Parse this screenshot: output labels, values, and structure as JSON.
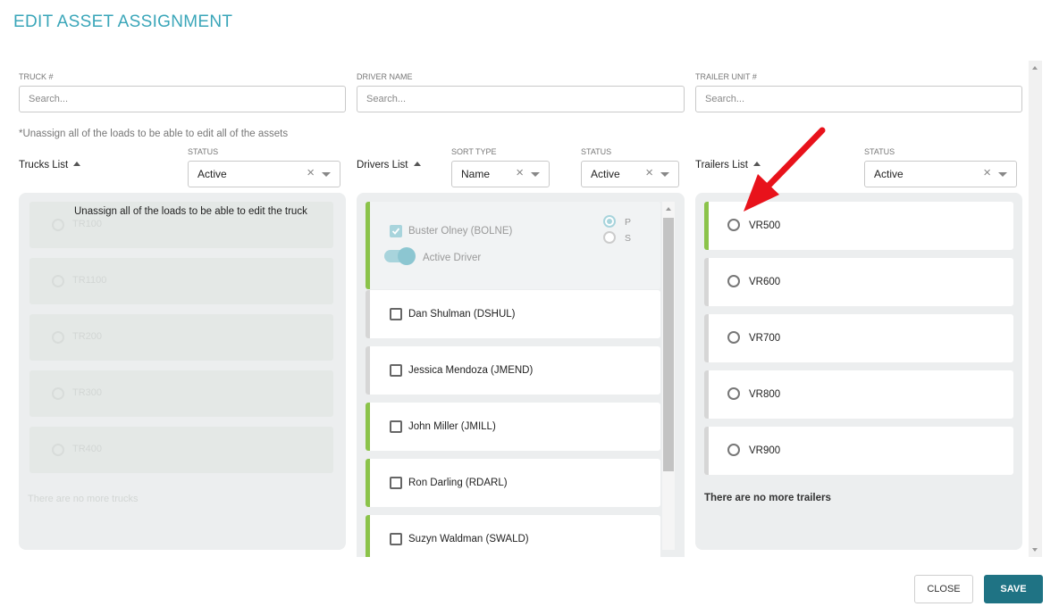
{
  "title": "EDIT ASSET ASSIGNMENT",
  "filters": {
    "truck": {
      "label": "TRUCK #",
      "placeholder": "Search..."
    },
    "driver": {
      "label": "DRIVER NAME",
      "placeholder": "Search..."
    },
    "trailer": {
      "label": "TRAILER UNIT #",
      "placeholder": "Search..."
    }
  },
  "note": "*Unassign all of the loads to be able to edit all of the assets",
  "trucks": {
    "title": "Trucks List",
    "status_label": "STATUS",
    "status_value": "Active",
    "overlay_message": "Unassign all of the loads to be able to edit the truck",
    "items": [
      "TR100",
      "TR1100",
      "TR200",
      "TR300",
      "TR400"
    ],
    "end_text": "There are no more trucks"
  },
  "drivers": {
    "title": "Drivers List",
    "sort_label": "SORT TYPE",
    "sort_value": "Name",
    "status_label": "STATUS",
    "status_value": "Active",
    "selected": {
      "name": "Buster Olney (BOLNE)",
      "toggle_label": "Active Driver",
      "primary_label": "P",
      "secondary_label": "S"
    },
    "items": [
      "Dan Shulman (DSHUL)",
      "Jessica Mendoza (JMEND)",
      "John Miller (JMILL)",
      "Ron Darling (RDARL)",
      "Suzyn Waldman (SWALD)"
    ]
  },
  "trailers": {
    "title": "Trailers List",
    "status_label": "STATUS",
    "status_value": "Active",
    "items": [
      "VR500",
      "VR600",
      "VR700",
      "VR800",
      "VR900"
    ],
    "end_text": "There are no more trailers"
  },
  "buttons": {
    "close": "CLOSE",
    "save": "SAVE"
  },
  "colors": {
    "accent": "#3aa6b9",
    "save": "#1f7384",
    "active_bar": "#8bc34a",
    "arrow": "#e8121b"
  }
}
